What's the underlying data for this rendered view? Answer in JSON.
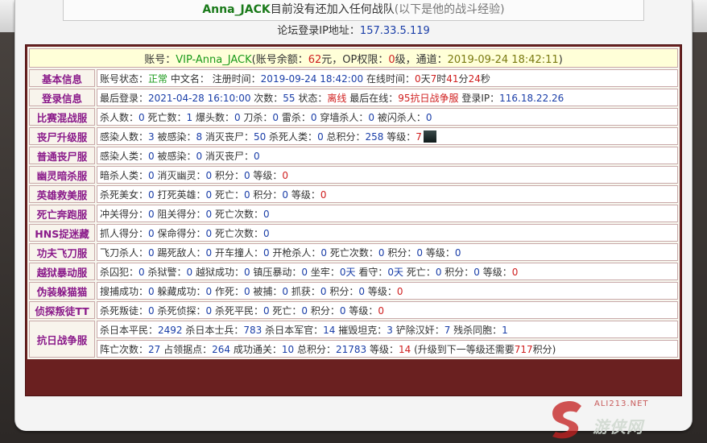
{
  "header": {
    "player_name": "Anna_JACK",
    "status_text": "目前没有还加入任何战队",
    "note": "(以下是他的战斗经验)"
  },
  "ip": {
    "label": "论坛登录IP地址：",
    "value": "157.33.5.119"
  },
  "account": {
    "label_account": "账号：",
    "account_name": "VIP-Anna_JACK",
    "balance_label": "(账号余额：",
    "balance_value": "62",
    "balance_unit": "元，OP权限：",
    "op_value": "0",
    "op_unit": "级，通道：",
    "channel_time": "2019-09-24 18:42:11",
    "close_paren": ")"
  },
  "rows": {
    "basic": {
      "category": "基本信息",
      "t1": "账号状态：",
      "v1": "正常",
      "t2": " 中文名： 注册时间：",
      "v2": "2019-09-24 18:42:00",
      "t3": " 在线时间：",
      "v3": "0",
      "t4": "天",
      "v4": "7",
      "t5": "时",
      "v5": "41",
      "t6": "分",
      "v6": "24",
      "t7": "秒"
    },
    "login": {
      "category": "登录信息",
      "t1": "最后登录：",
      "v1": "2021-04-28 16:10:00",
      "t2": " 次数：",
      "v2": "55",
      "t3": " 状态：",
      "v3": "离线",
      "t4": " 最后在线：",
      "v4": "95抗日战争服",
      "t5": " 登录IP：",
      "v5": "116.18.22.26"
    },
    "mixed": {
      "category": "比赛混战服",
      "t1": "杀人数：",
      "v1": "0",
      "t2": " 死亡数：",
      "v2": "1",
      "t3": " 爆头数：",
      "v3": "0",
      "t4": " 刀杀：",
      "v4": "0",
      "t5": " 雷杀：",
      "v5": "0",
      "t6": " 穿墙杀人：",
      "v6": "0",
      "t7": " 被闪杀人：",
      "v7": "0"
    },
    "zombie_up": {
      "category": "丧尸升级服",
      "t1": "感染人数：",
      "v1": "3",
      "t2": " 被感染：",
      "v2": "8",
      "t3": " 消灭丧尸：",
      "v3": "50",
      "t4": " 杀死人类：",
      "v4": "0",
      "t5": " 总积分：",
      "v5": "258",
      "t6": " 等级：",
      "v6": "7"
    },
    "zombie": {
      "category": "普通丧尸服",
      "t1": "感染人类：",
      "v1": "0",
      "t2": " 被感染：",
      "v2": "0",
      "t3": " 消灭丧尸：",
      "v3": "0"
    },
    "ghost": {
      "category": "幽灵暗杀服",
      "t1": "暗杀人类：",
      "v1": "0",
      "t2": " 消灭幽灵：",
      "v2": "0",
      "t3": " 积分：",
      "v3": "0",
      "t4": " 等级：",
      "v4": "0"
    },
    "hero": {
      "category": "英雄救美服",
      "t1": "杀死美女：",
      "v1": "0",
      "t2": " 打死英雄：",
      "v2": "0",
      "t3": " 死亡：",
      "v3": "0",
      "t4": " 积分：",
      "v4": "0",
      "t5": " 等级：",
      "v5": "0"
    },
    "run": {
      "category": "死亡奔跑服",
      "t1": "冲关得分：",
      "v1": "0",
      "t2": " 阻关得分：",
      "v2": "0",
      "t3": " 死亡次数：",
      "v3": "0"
    },
    "hns": {
      "category": "HNS捉迷藏",
      "t1": "抓人得分：",
      "v1": "0",
      "t2": " 保命得分：",
      "v2": "0",
      "t3": " 死亡次数：",
      "v3": "0"
    },
    "kungfu": {
      "category": "功夫飞刀服",
      "t1": "飞刀杀人：",
      "v1": "0",
      "t2": " 踢死敌人：",
      "v2": "0",
      "t3": " 开车撞人：",
      "v3": "0",
      "t4": " 开枪杀人：",
      "v4": "0",
      "t5": " 死亡次数：",
      "v5": "0",
      "t6": " 积分：",
      "v6": "0",
      "t7": " 等级：",
      "v7": "0"
    },
    "jail": {
      "category": "越狱暴动服",
      "t1": "杀囚犯：",
      "v1": "0",
      "t2": " 杀狱警：",
      "v2": "0",
      "t3": " 越狱成功：",
      "v3": "0",
      "t4": " 镇压暴动：",
      "v4": "0",
      "t5": " 坐牢：",
      "v5": "0天",
      "t6": " 看守：",
      "v6": "0天",
      "t7": " 死亡：",
      "v7": "0",
      "t8": " 积分：",
      "v8": "0",
      "t9": " 等级：",
      "v9": "0"
    },
    "hide": {
      "category": "伪装躲猫猫",
      "t1": "搜捕成功：",
      "v1": "0",
      "t2": " 躲藏成功：",
      "v2": "0",
      "t3": " 作死：",
      "v3": "0",
      "t4": " 被捕：",
      "v4": "0",
      "t5": " 抓获：",
      "v5": "0",
      "t6": " 积分：",
      "v6": "0",
      "t7": " 等级：",
      "v7": "0"
    },
    "traitor": {
      "category": "侦探叛徒TT",
      "t1": "杀死叛徒：",
      "v1": "0",
      "t2": " 杀死侦探：",
      "v2": "0",
      "t3": " 杀死平民：",
      "v3": "0",
      "t4": " 死亡：",
      "v4": "0",
      "t5": " 积分：",
      "v5": "0",
      "t6": " 等级：",
      "v6": "0"
    },
    "war": {
      "category": "抗日战争服",
      "line1": {
        "t1": "杀日本平民：",
        "v1": "2492",
        "t2": " 杀日本士兵：",
        "v2": "783",
        "t3": " 杀日本军官：",
        "v3": "14",
        "t4": " 摧毁坦克：",
        "v4": "3",
        "t5": " 铲除汉奸：",
        "v5": "7",
        "t6": " 残杀同胞：",
        "v6": "1"
      },
      "line2": {
        "t1": "阵亡次数：",
        "v1": "27",
        "t2": " 占领据点：",
        "v2": "264",
        "t3": " 成功通关：",
        "v3": "10",
        "t4": " 总积分：",
        "v4": "21783",
        "t5": " 等级：",
        "v5": "14",
        "t6": " (升级到下一等级还需要",
        "v6": "717",
        "t7": "积分)"
      }
    }
  },
  "watermark": {
    "text": "游侠网",
    "top": "ALI213.NET"
  },
  "colors": {
    "accent_blue": "#1a3ea8",
    "accent_red": "#d02020",
    "category_purple": "#8a1a8a",
    "border_maroon": "#6a2020"
  }
}
